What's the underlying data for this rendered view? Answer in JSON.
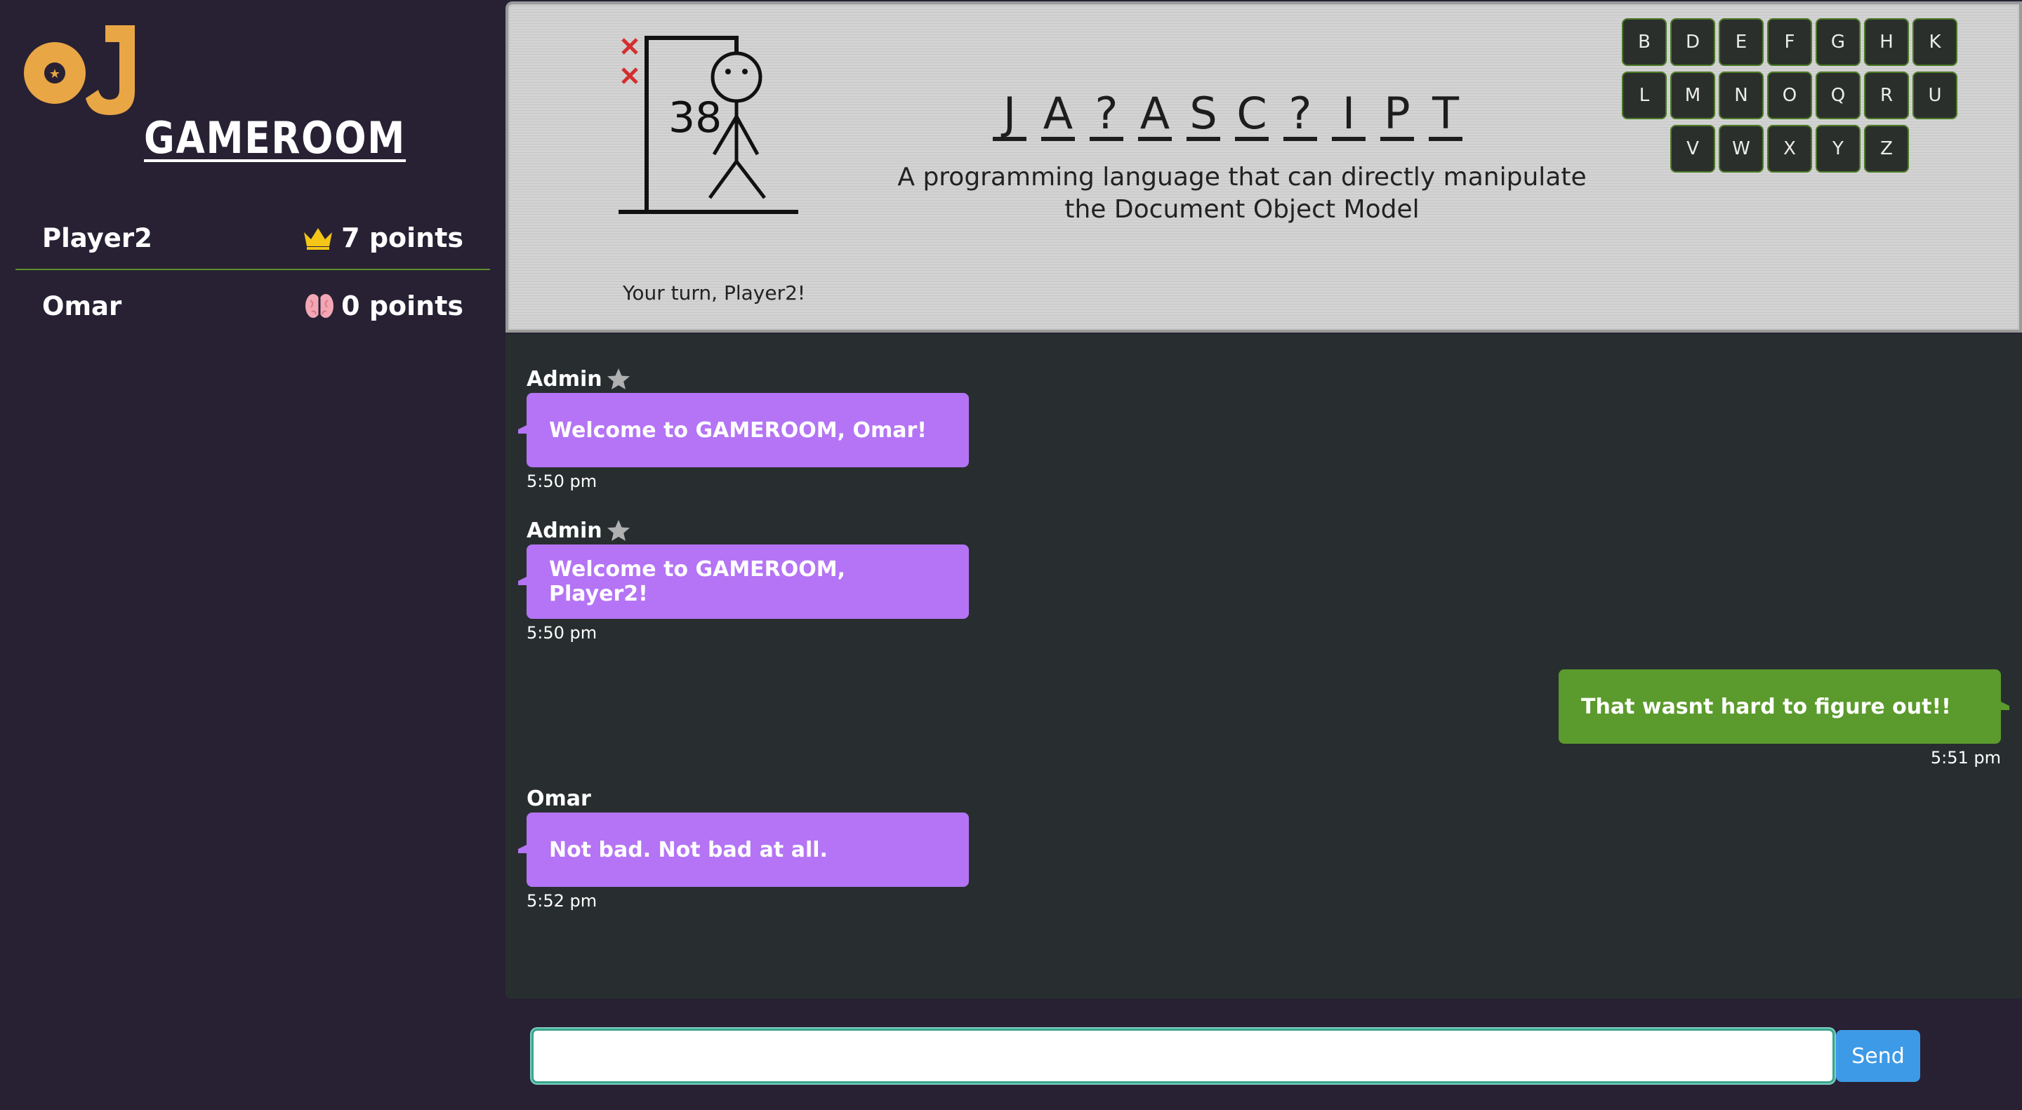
{
  "app": {
    "logo_letter": "J",
    "title": "GAMEROOM"
  },
  "players": [
    {
      "name": "Player2",
      "score": "7 points",
      "icon": "crown-icon"
    },
    {
      "name": "Omar",
      "score": "0 points",
      "icon": "brain-icon"
    }
  ],
  "game": {
    "wrong_guesses_marks": 2,
    "counter": "38",
    "puzzle": [
      "J",
      "A",
      "?",
      "A",
      "S",
      "C",
      "?",
      "I",
      "P",
      "T"
    ],
    "hint": "A programming language that can directly manipulate the Document Object Model",
    "turn_text": "Your turn, Player2!",
    "keyboard": [
      [
        "B",
        "D",
        "E",
        "F",
        "G",
        "H",
        "K"
      ],
      [
        "L",
        "M",
        "N",
        "O",
        "Q",
        "R",
        "U"
      ],
      [
        "V",
        "W",
        "X",
        "Y",
        "Z"
      ]
    ]
  },
  "messages": [
    {
      "sender": "Admin",
      "admin": true,
      "text": "Welcome to GAMEROOM, Omar!",
      "time": "5:50 pm",
      "side": "left"
    },
    {
      "sender": "Admin",
      "admin": true,
      "text": "Welcome to GAMEROOM, Player2!",
      "time": "5:50 pm",
      "side": "left"
    },
    {
      "sender": "",
      "admin": false,
      "text": "That wasnt hard to figure out!!",
      "time": "5:51 pm",
      "side": "right"
    },
    {
      "sender": "Omar",
      "admin": false,
      "text": "Not bad. Not bad at all.",
      "time": "5:52 pm",
      "side": "left"
    }
  ],
  "input": {
    "value": "",
    "send_label": "Send"
  },
  "colors": {
    "sidebar_bg": "#272133",
    "accent_orange": "#e9a645",
    "bubble_purple": "#b474f5",
    "bubble_green": "#5b9a2c",
    "send_blue": "#3d9ae6"
  }
}
